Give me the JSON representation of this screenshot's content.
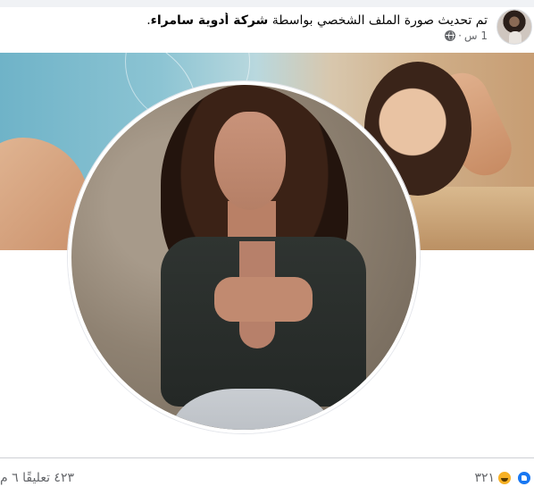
{
  "post": {
    "headline_prefix": "تم تحديث صورة الملف الشخصي بواسطة",
    "page_name": "شركة أدوية سامراء",
    "headline_suffix": ".",
    "timestamp": "1 س",
    "separator": "·",
    "privacy_icon": "globe-icon"
  },
  "footer": {
    "reaction_count": "٣٢١",
    "reaction_icons": [
      "like-icon",
      "haha-icon"
    ],
    "comments_text": "٤٢٣ تعليقًا",
    "shares_text": "٦ م"
  },
  "colors": {
    "secondary_text": "#65676b",
    "like_blue": "#1877f2",
    "haha_yellow": "#f7b125",
    "divider": "#ced0d4"
  }
}
